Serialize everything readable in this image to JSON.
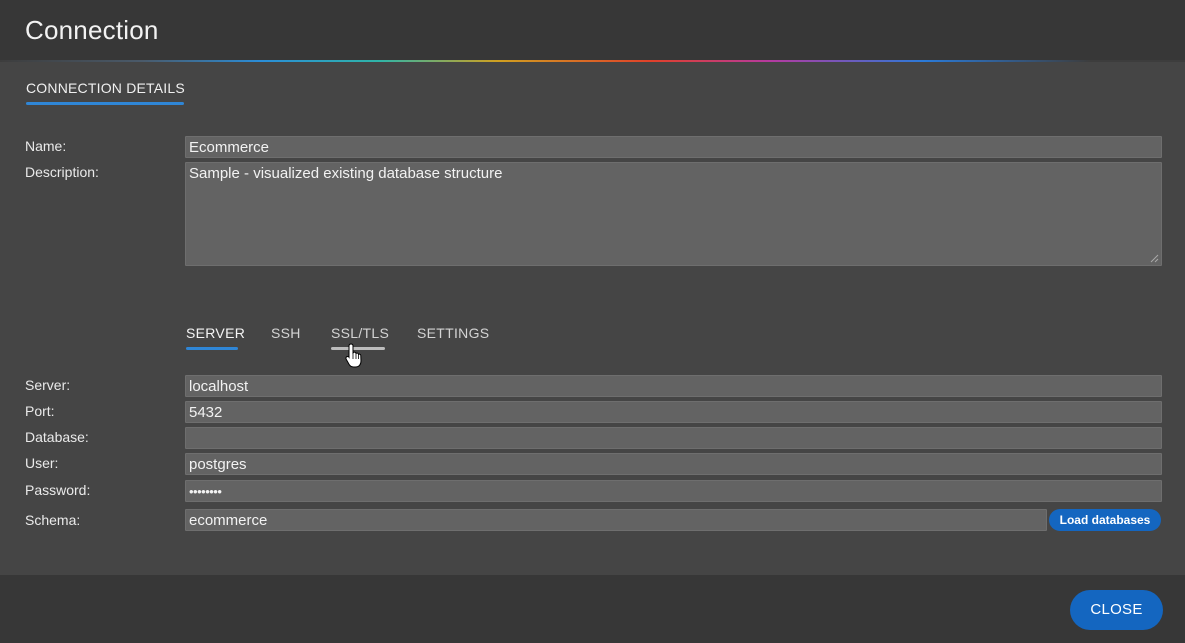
{
  "dialog": {
    "title": "Connection"
  },
  "section_tab": {
    "label": "CONNECTION DETAILS"
  },
  "fields": {
    "name_label": "Name:",
    "name_value": "Ecommerce",
    "description_label": "Description:",
    "description_value": "Sample - visualized existing database structure"
  },
  "subtabs": [
    {
      "label": "SERVER",
      "active": true
    },
    {
      "label": "SSH",
      "active": false
    },
    {
      "label": "SSL/TLS",
      "active": false,
      "hovered": true
    },
    {
      "label": "SETTINGS",
      "active": false
    }
  ],
  "server": {
    "server_label": "Server:",
    "server_value": "localhost",
    "port_label": "Port:",
    "port_value": "5432",
    "database_label": "Database:",
    "database_value": "",
    "user_label": "User:",
    "user_value": "postgres",
    "password_label": "Password:",
    "password_value": "••••••••",
    "schema_label": "Schema:",
    "schema_value": "ecommerce",
    "load_button": "Load databases"
  },
  "footer": {
    "close_label": "CLOSE"
  },
  "colors": {
    "accent": "#1466c0",
    "tab_underline": "#2f86d6",
    "background": "#454545",
    "header": "#373737",
    "field": "#636363"
  }
}
